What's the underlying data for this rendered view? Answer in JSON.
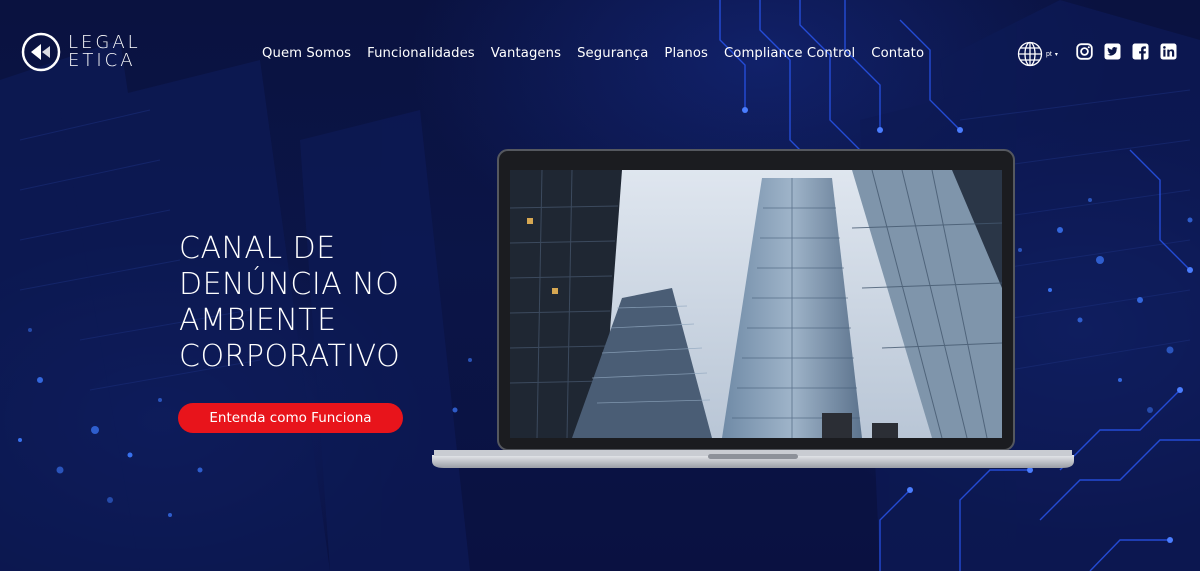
{
  "brand": {
    "line1": "LEGAL",
    "line2": "ETICA"
  },
  "nav": {
    "items": [
      {
        "label": "Quem Somos"
      },
      {
        "label": "Funcionalidades"
      },
      {
        "label": "Vantagens"
      },
      {
        "label": "Segurança"
      },
      {
        "label": "Planos"
      },
      {
        "label": "Compliance Control"
      },
      {
        "label": "Contato"
      }
    ]
  },
  "language": {
    "code": "pt",
    "caret": "▾",
    "icon": "globe-icon"
  },
  "social": [
    {
      "name": "instagram-icon"
    },
    {
      "name": "twitter-icon"
    },
    {
      "name": "facebook-icon"
    },
    {
      "name": "linkedin-icon"
    }
  ],
  "hero": {
    "title_lines": [
      "CANAL DE",
      "DENÚNCIA NO",
      "AMBIENTE",
      "CORPORATIVO"
    ],
    "cta_label": "Entenda como Funciona"
  },
  "colors": {
    "background": "#0a1240",
    "accent_red": "#e8141b",
    "text": "#ffffff",
    "circuit": "#2c5cff"
  }
}
